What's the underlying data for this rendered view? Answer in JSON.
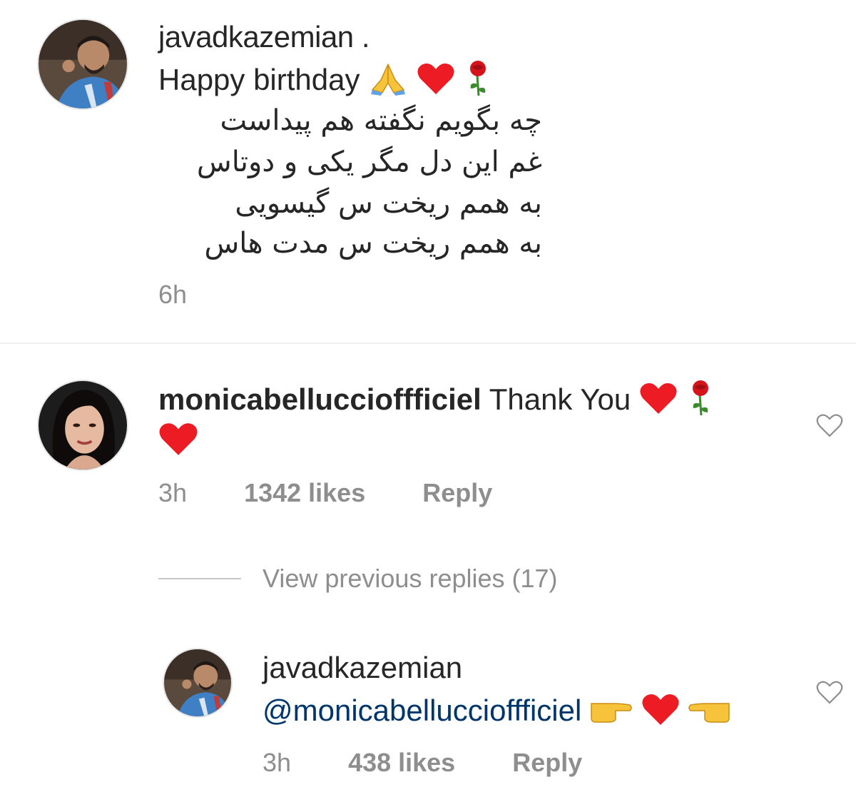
{
  "comment1": {
    "username": "javadkazemian .",
    "text": "Happy birthday",
    "emojis": [
      "folded-hands-icon",
      "red-heart-icon",
      "rose-icon"
    ],
    "persian_lines": [
      "چه بگویم نگفته هم پیداست",
      "غم این دل مگر یکی و دوتاس",
      "به همم ریخت س گیسویی",
      "به همم ریخت س مدت هاس"
    ],
    "time": "6h"
  },
  "comment2": {
    "username": "monicabelluccioffficiel",
    "text": "Thank You",
    "emojis": [
      "red-heart-icon",
      "rose-icon",
      "red-heart-icon"
    ],
    "time": "3h",
    "likes": "1342 likes",
    "reply": "Reply"
  },
  "view_previous": "View previous replies (17)",
  "reply1": {
    "username": "javadkazemian",
    "mention": "@monicabelluccioffficiel",
    "emojis": [
      "pointing-right-icon",
      "red-heart-icon",
      "pointing-left-icon"
    ],
    "time": "3h",
    "likes": "438 likes",
    "reply": "Reply"
  },
  "colors": {
    "text": "#262626",
    "meta": "#8e8e8e",
    "mention": "#003569",
    "heart": "#ed1c24",
    "divider": "#efefef"
  }
}
